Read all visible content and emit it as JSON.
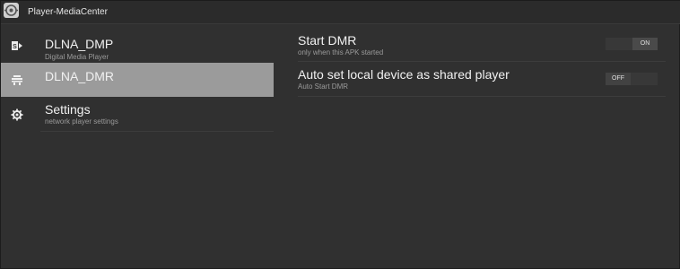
{
  "window": {
    "title": "Player-MediaCenter",
    "app_icon": "player-mediacenter-app-icon"
  },
  "sidebar": {
    "items": [
      {
        "label": "DLNA_DMP",
        "subtitle": "Digital Media Player",
        "icon": "share-forward-icon",
        "selected": false
      },
      {
        "label": "DLNA_DMR",
        "subtitle": "",
        "icon": "dmr-tray-icon",
        "selected": true
      },
      {
        "label": "Settings",
        "subtitle": "network player settings",
        "icon": "gear-icon",
        "selected": false
      }
    ]
  },
  "settings": [
    {
      "title": "Start DMR",
      "subtitle": "only when this APK started",
      "toggle": {
        "state": "ON"
      }
    },
    {
      "title": "Auto set local device as shared player",
      "subtitle": "Auto Start DMR",
      "toggle": {
        "state": "OFF"
      }
    }
  ],
  "colors": {
    "background": "#303030",
    "selected_item": "#9b9b9b",
    "text_primary": "#f1f1f1",
    "text_secondary": "#9a9a9a"
  }
}
